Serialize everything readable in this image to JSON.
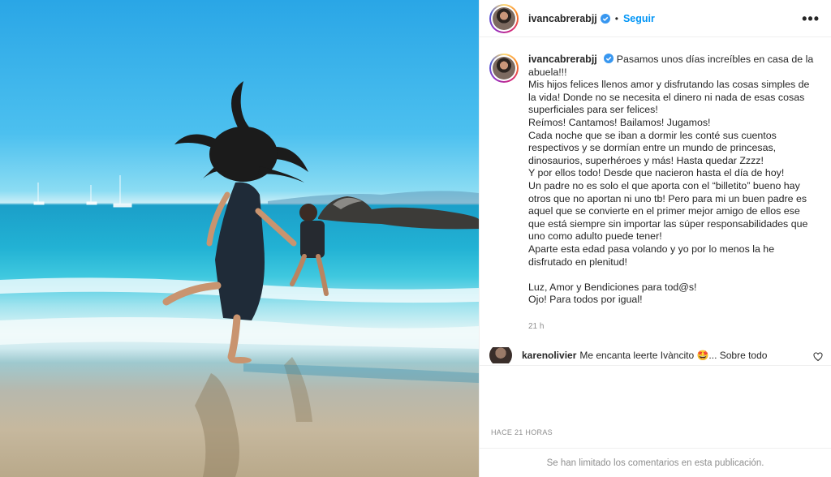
{
  "post": {
    "username": "ivancabrerabjj",
    "follow_label": "Seguir",
    "separator": "•",
    "more_label": "•••",
    "caption_lines": [
      "Pasamos unos días increíbles en casa de la abuela!!!",
      "Mis hijos felices llenos amor y disfrutando las cosas simples de la vida! Donde no se necesita el dinero ni nada de esas cosas superficiales para ser felices!",
      "Reímos! Cantamos! Bailamos! Jugamos!",
      "Cada noche que se iban a dormir les conté sus cuentos respectivos y se dormían entre un mundo de princesas, dinosaurios, superhéroes y más! Hasta quedar Zzzz!",
      "Y por ellos todo! Desde que nacieron hasta el día de hoy!",
      "Un padre no es solo el que aporta con el “billetito” bueno hay otros que no aportan ni uno tb! Pero para mi un buen padre es aquel que se convierte en el primer mejor amigo de ellos ese que está siempre sin importar las súper responsabilidades que uno como adulto puede tener!",
      "Aparte esta edad pasa volando y yo por lo menos la he disfrutado en plenitud!",
      "",
      "Luz, Amor y Bendiciones para tod@s!",
      "Ojo! Para todos por igual!"
    ],
    "time": "21 h",
    "comment": {
      "username": "karenolivier",
      "text": "Me encanta leerte Ivàncito 🤩... Sobre todo"
    },
    "timestamp": "HACE 21 HORAS",
    "comments_limited": "Se han limitado los comentarios en esta publicación.",
    "accent_color": "#0095f6"
  }
}
